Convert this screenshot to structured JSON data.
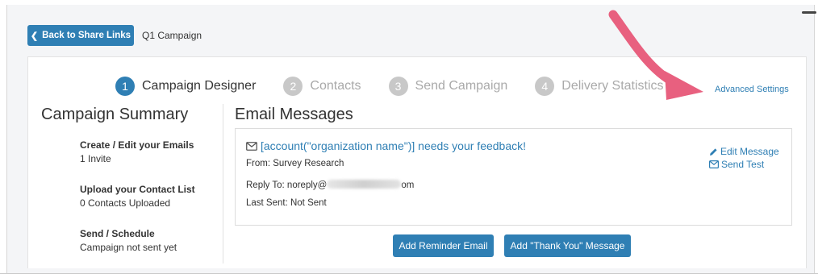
{
  "topbar": {
    "back_label": "Back to Share Links",
    "breadcrumb": "Q1 Campaign"
  },
  "steps": [
    {
      "num": "1",
      "label": "Campaign Designer",
      "state": "active"
    },
    {
      "num": "2",
      "label": "Contacts",
      "state": "inactive"
    },
    {
      "num": "3",
      "label": "Send Campaign",
      "state": "inactive"
    },
    {
      "num": "4",
      "label": "Delivery Statistics",
      "state": "inactive"
    }
  ],
  "advanced_settings": "Advanced Settings",
  "summary": {
    "title": "Campaign Summary",
    "items": [
      {
        "title": "Create / Edit your Emails",
        "sub": "1 Invite"
      },
      {
        "title": "Upload your Contact List",
        "sub": "0 Contacts Uploaded"
      },
      {
        "title": "Send / Schedule",
        "sub": "Campaign not sent yet"
      }
    ]
  },
  "emails": {
    "title": "Email Messages",
    "message": {
      "subject": "[account(\"organization name\")] needs your feedback!",
      "from": "From: Survey Research",
      "reply_prefix": "Reply To: noreply@",
      "reply_suffix": "om",
      "last_sent": "Last Sent: Not Sent"
    },
    "edit_label": "Edit Message",
    "send_test_label": "Send Test",
    "add_reminder_label": "Add Reminder Email",
    "add_thankyou_label": "Add \"Thank You\" Message"
  },
  "colors": {
    "accent": "#2f7fb4",
    "annotation_arrow": "#e8607f",
    "inactive_step": "#c8c8c8"
  },
  "icons": {
    "back": "chevron-left-icon",
    "subject": "envelope-icon",
    "edit": "pencil-icon",
    "send_test": "envelope-icon"
  }
}
